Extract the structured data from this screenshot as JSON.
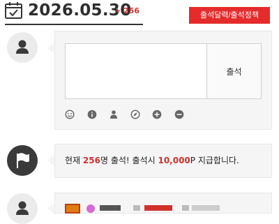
{
  "header": {
    "date": "2026.05.30",
    "increment": "+ 256",
    "calendar_button": "출석달력/출석정책"
  },
  "form": {
    "memo_placeholder": "",
    "submit_label": "출석",
    "toolbar_icons": [
      "smiley-icon",
      "info-icon",
      "person-icon",
      "compass-icon",
      "plus-circle-icon",
      "minus-circle-icon"
    ]
  },
  "notice": {
    "prefix": "현재 ",
    "count": "256",
    "middle": "명 출석! 출석시 ",
    "points": "10,000",
    "suffix": "P 지급합니다."
  },
  "colors": {
    "accent": "#e52b2b",
    "red_text": "#d0312d",
    "box_bg": "#f5f5f5"
  }
}
